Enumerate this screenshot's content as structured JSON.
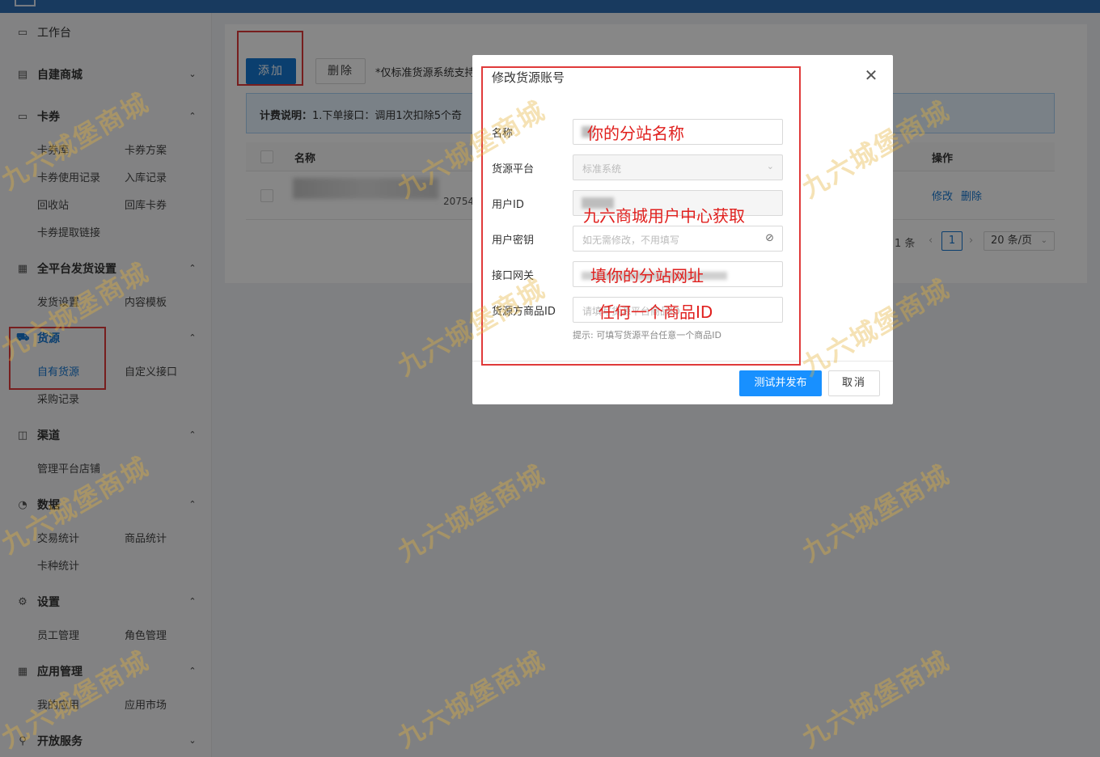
{
  "sidebar": {
    "workbench": "工作台",
    "mall": "自建商城",
    "coupon": {
      "title": "卡券",
      "items": [
        "卡券库",
        "卡券方案",
        "卡券使用记录",
        "入库记录",
        "回收站",
        "回库卡券",
        "卡券提取链接"
      ]
    },
    "delivery": {
      "title": "全平台发货设置",
      "items": [
        "发货设置",
        "内容模板"
      ]
    },
    "source": {
      "title": "货源",
      "items": [
        "自有货源",
        "自定义接口",
        "采购记录"
      ]
    },
    "channel": {
      "title": "渠道",
      "items": [
        "管理平台店铺"
      ]
    },
    "data": {
      "title": "数据",
      "items": [
        "交易统计",
        "商品统计",
        "卡种统计"
      ]
    },
    "settings": {
      "title": "设置",
      "items": [
        "员工管理",
        "角色管理"
      ]
    },
    "apps": {
      "title": "应用管理",
      "items": [
        "我的应用",
        "应用市场"
      ]
    },
    "open": {
      "title": "开放服务"
    }
  },
  "main": {
    "add_button": "添加",
    "delete_button": "删除",
    "note": "*仅标准货源系统支持自",
    "billing_label": "计费说明：",
    "billing_text": "1.下单接口：调用1次扣除5个奇",
    "col_name": "名称",
    "col_op": "操作",
    "row_num": "20754",
    "row_edit": "修改",
    "row_delete": "删除",
    "pager_total": "1 条",
    "pager_page": "1",
    "pager_size": "20 条/页"
  },
  "modal": {
    "title": "修改货源账号",
    "fields": {
      "name_label": "名称",
      "platform_label": "货源平台",
      "platform_value": "标准系统",
      "userid_label": "用户ID",
      "key_label": "用户密钥",
      "key_placeholder": "如无需修改，不用填写",
      "gateway_label": "接口网关",
      "goods_label": "货源方商品ID",
      "goods_placeholder": "请填写货源平台商品ID"
    },
    "hint": "提示: 可填写货源平台任意一个商品ID",
    "ok_button": "测试并发布",
    "cancel_button": "取消"
  },
  "annotations": {
    "name": "你的分站名称",
    "userid": "九六商城用户中心获取",
    "gateway": "填你的分站网址",
    "goods": "任何一个商品ID"
  },
  "watermark": "九六城堡商城",
  "colors": {
    "primary": "#1677d2",
    "annotation_red": "#e03a3a",
    "topbar": "#2f6fb4"
  }
}
